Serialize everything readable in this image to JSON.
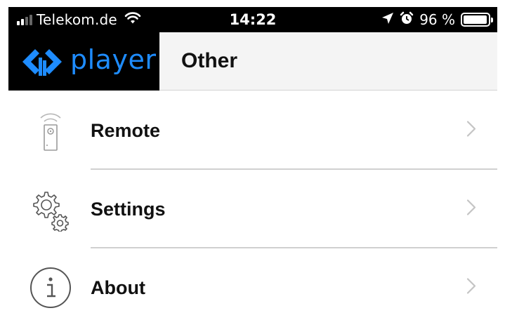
{
  "status_bar": {
    "carrier": "Telekom.de",
    "time": "14:22",
    "battery_text": "96 %",
    "battery_level": 0.96,
    "icons": [
      "signal-icon",
      "wifi-icon",
      "location-arrow-icon",
      "alarm-icon",
      "battery-icon"
    ]
  },
  "nav": {
    "logo_text": "player",
    "title": "Other",
    "brand_color": "#1e8cff"
  },
  "menu": {
    "items": [
      {
        "label": "Remote",
        "icon": "remote-control-icon"
      },
      {
        "label": "Settings",
        "icon": "gears-icon"
      },
      {
        "label": "About",
        "icon": "info-icon"
      }
    ]
  }
}
